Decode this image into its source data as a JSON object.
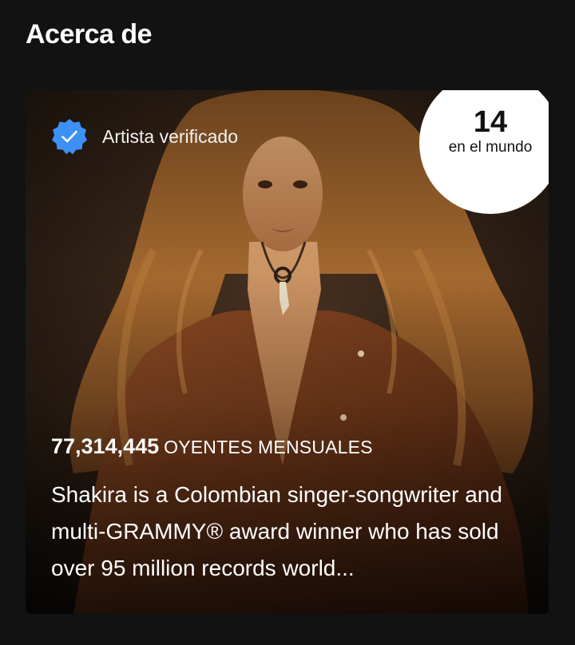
{
  "section": {
    "title": "Acerca de"
  },
  "card": {
    "verified_label": "Artista verificado",
    "verified_icon": "verified-badge-icon",
    "rank_number": "14",
    "rank_caption": "en el mundo",
    "listeners_count": "77,314,445",
    "listeners_label": "OYENTES MENSUALES",
    "bio": "Shakira is a Colombian singer-songwriter and multi-GRAMMY® award winner who has sold over 95 million records world..."
  },
  "colors": {
    "background": "#121212",
    "verified_blue": "#3d91f4",
    "badge_bg": "#ffffff"
  }
}
